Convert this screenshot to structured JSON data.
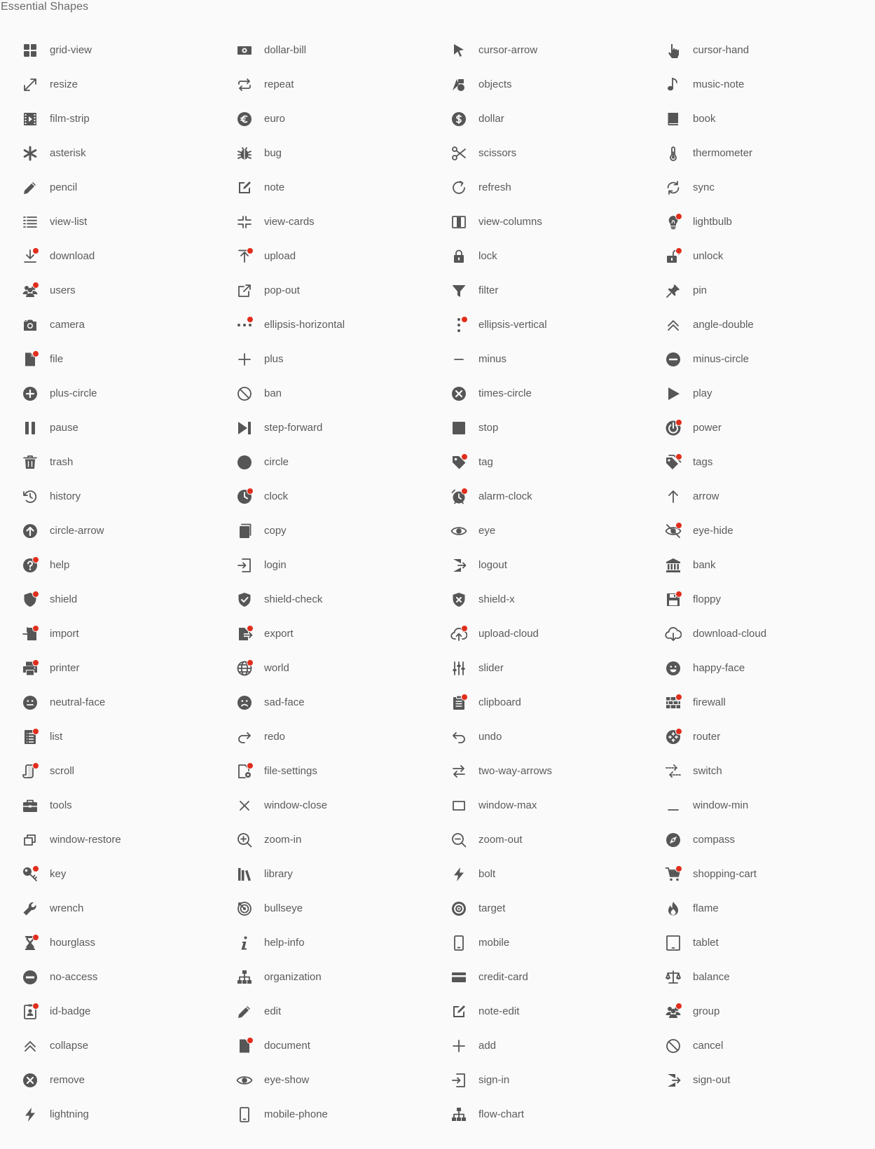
{
  "page": {
    "title": "Essential Shapes"
  },
  "colors": {
    "icon": "#565656",
    "text": "#5b5b5b",
    "badge": "#e12e1c",
    "background": "#fafafa"
  },
  "shapes": [
    {
      "label": "grid-view",
      "badge": false
    },
    {
      "label": "dollar-bill",
      "badge": false
    },
    {
      "label": "cursor-arrow",
      "badge": false
    },
    {
      "label": "cursor-hand",
      "badge": false
    },
    {
      "label": "resize",
      "badge": false
    },
    {
      "label": "repeat",
      "badge": false
    },
    {
      "label": "objects",
      "badge": false
    },
    {
      "label": "music-note",
      "badge": false
    },
    {
      "label": "film-strip",
      "badge": false
    },
    {
      "label": "euro",
      "badge": false
    },
    {
      "label": "dollar",
      "badge": false
    },
    {
      "label": "book",
      "badge": false
    },
    {
      "label": "asterisk",
      "badge": false
    },
    {
      "label": "bug",
      "badge": false
    },
    {
      "label": "scissors",
      "badge": false
    },
    {
      "label": "thermometer",
      "badge": false
    },
    {
      "label": "pencil",
      "badge": false
    },
    {
      "label": "note",
      "badge": false
    },
    {
      "label": "refresh",
      "badge": false
    },
    {
      "label": "sync",
      "badge": false
    },
    {
      "label": "view-list",
      "badge": false
    },
    {
      "label": "view-cards",
      "badge": false
    },
    {
      "label": "view-columns",
      "badge": false
    },
    {
      "label": "lightbulb",
      "badge": true
    },
    {
      "label": "download",
      "badge": true
    },
    {
      "label": "upload",
      "badge": true
    },
    {
      "label": "lock",
      "badge": false
    },
    {
      "label": "unlock",
      "badge": true
    },
    {
      "label": "users",
      "badge": true
    },
    {
      "label": "pop-out",
      "badge": false
    },
    {
      "label": "filter",
      "badge": false
    },
    {
      "label": "pin",
      "badge": false
    },
    {
      "label": "camera",
      "badge": false
    },
    {
      "label": "ellipsis-horizontal",
      "badge": true
    },
    {
      "label": "ellipsis-vertical",
      "badge": true
    },
    {
      "label": "angle-double",
      "badge": false
    },
    {
      "label": "file",
      "badge": true
    },
    {
      "label": "plus",
      "badge": false
    },
    {
      "label": "minus",
      "badge": false
    },
    {
      "label": "minus-circle",
      "badge": false
    },
    {
      "label": "plus-circle",
      "badge": false
    },
    {
      "label": "ban",
      "badge": false
    },
    {
      "label": "times-circle",
      "badge": false
    },
    {
      "label": "play",
      "badge": false
    },
    {
      "label": "pause",
      "badge": false
    },
    {
      "label": "step-forward",
      "badge": false
    },
    {
      "label": "stop",
      "badge": false
    },
    {
      "label": "power",
      "badge": true
    },
    {
      "label": "trash",
      "badge": false
    },
    {
      "label": "circle",
      "badge": false
    },
    {
      "label": "tag",
      "badge": true
    },
    {
      "label": "tags",
      "badge": true
    },
    {
      "label": "history",
      "badge": false
    },
    {
      "label": "clock",
      "badge": true
    },
    {
      "label": "alarm-clock",
      "badge": true
    },
    {
      "label": "arrow",
      "badge": false
    },
    {
      "label": "circle-arrow",
      "badge": false
    },
    {
      "label": "copy",
      "badge": false
    },
    {
      "label": "eye",
      "badge": false
    },
    {
      "label": "eye-hide",
      "badge": true
    },
    {
      "label": "help",
      "badge": true
    },
    {
      "label": "login",
      "badge": false
    },
    {
      "label": "logout",
      "badge": false
    },
    {
      "label": "bank",
      "badge": false
    },
    {
      "label": "shield",
      "badge": true
    },
    {
      "label": "shield-check",
      "badge": false
    },
    {
      "label": "shield-x",
      "badge": false
    },
    {
      "label": "floppy",
      "badge": true
    },
    {
      "label": "import",
      "badge": true
    },
    {
      "label": "export",
      "badge": true
    },
    {
      "label": "upload-cloud",
      "badge": true
    },
    {
      "label": "download-cloud",
      "badge": false
    },
    {
      "label": "printer",
      "badge": true
    },
    {
      "label": "world",
      "badge": true
    },
    {
      "label": "slider",
      "badge": false
    },
    {
      "label": "happy-face",
      "badge": false
    },
    {
      "label": "neutral-face",
      "badge": false
    },
    {
      "label": "sad-face",
      "badge": false
    },
    {
      "label": "clipboard",
      "badge": true
    },
    {
      "label": "firewall",
      "badge": true
    },
    {
      "label": "list",
      "badge": true
    },
    {
      "label": "redo",
      "badge": false
    },
    {
      "label": "undo",
      "badge": false
    },
    {
      "label": "router",
      "badge": true
    },
    {
      "label": "scroll",
      "badge": true
    },
    {
      "label": "file-settings",
      "badge": true
    },
    {
      "label": "two-way-arrows",
      "badge": false
    },
    {
      "label": "switch",
      "badge": false
    },
    {
      "label": "tools",
      "badge": false
    },
    {
      "label": "window-close",
      "badge": false
    },
    {
      "label": "window-max",
      "badge": false
    },
    {
      "label": "window-min",
      "badge": false
    },
    {
      "label": "window-restore",
      "badge": false
    },
    {
      "label": "zoom-in",
      "badge": false
    },
    {
      "label": "zoom-out",
      "badge": false
    },
    {
      "label": "compass",
      "badge": false
    },
    {
      "label": "key",
      "badge": true
    },
    {
      "label": "library",
      "badge": false
    },
    {
      "label": "bolt",
      "badge": false
    },
    {
      "label": "shopping-cart",
      "badge": true
    },
    {
      "label": "wrench",
      "badge": false
    },
    {
      "label": "bullseye",
      "badge": false
    },
    {
      "label": "target",
      "badge": false
    },
    {
      "label": "flame",
      "badge": false
    },
    {
      "label": "hourglass",
      "badge": true
    },
    {
      "label": "help-info",
      "badge": false
    },
    {
      "label": "mobile",
      "badge": false
    },
    {
      "label": "tablet",
      "badge": false
    },
    {
      "label": "no-access",
      "badge": false
    },
    {
      "label": "organization",
      "badge": false
    },
    {
      "label": "credit-card",
      "badge": false
    },
    {
      "label": "balance",
      "badge": false
    },
    {
      "label": "id-badge",
      "badge": true
    },
    {
      "label": "edit",
      "badge": false
    },
    {
      "label": "note-edit",
      "badge": false
    },
    {
      "label": "group",
      "badge": true
    },
    {
      "label": "collapse",
      "badge": false
    },
    {
      "label": "document",
      "badge": true
    },
    {
      "label": "add",
      "badge": false
    },
    {
      "label": "cancel",
      "badge": false
    },
    {
      "label": "remove",
      "badge": false
    },
    {
      "label": "eye-show",
      "badge": false
    },
    {
      "label": "sign-in",
      "badge": false
    },
    {
      "label": "sign-out",
      "badge": false
    },
    {
      "label": "lightning",
      "badge": false
    },
    {
      "label": "mobile-phone",
      "badge": false
    },
    {
      "label": "flow-chart",
      "badge": false
    }
  ]
}
